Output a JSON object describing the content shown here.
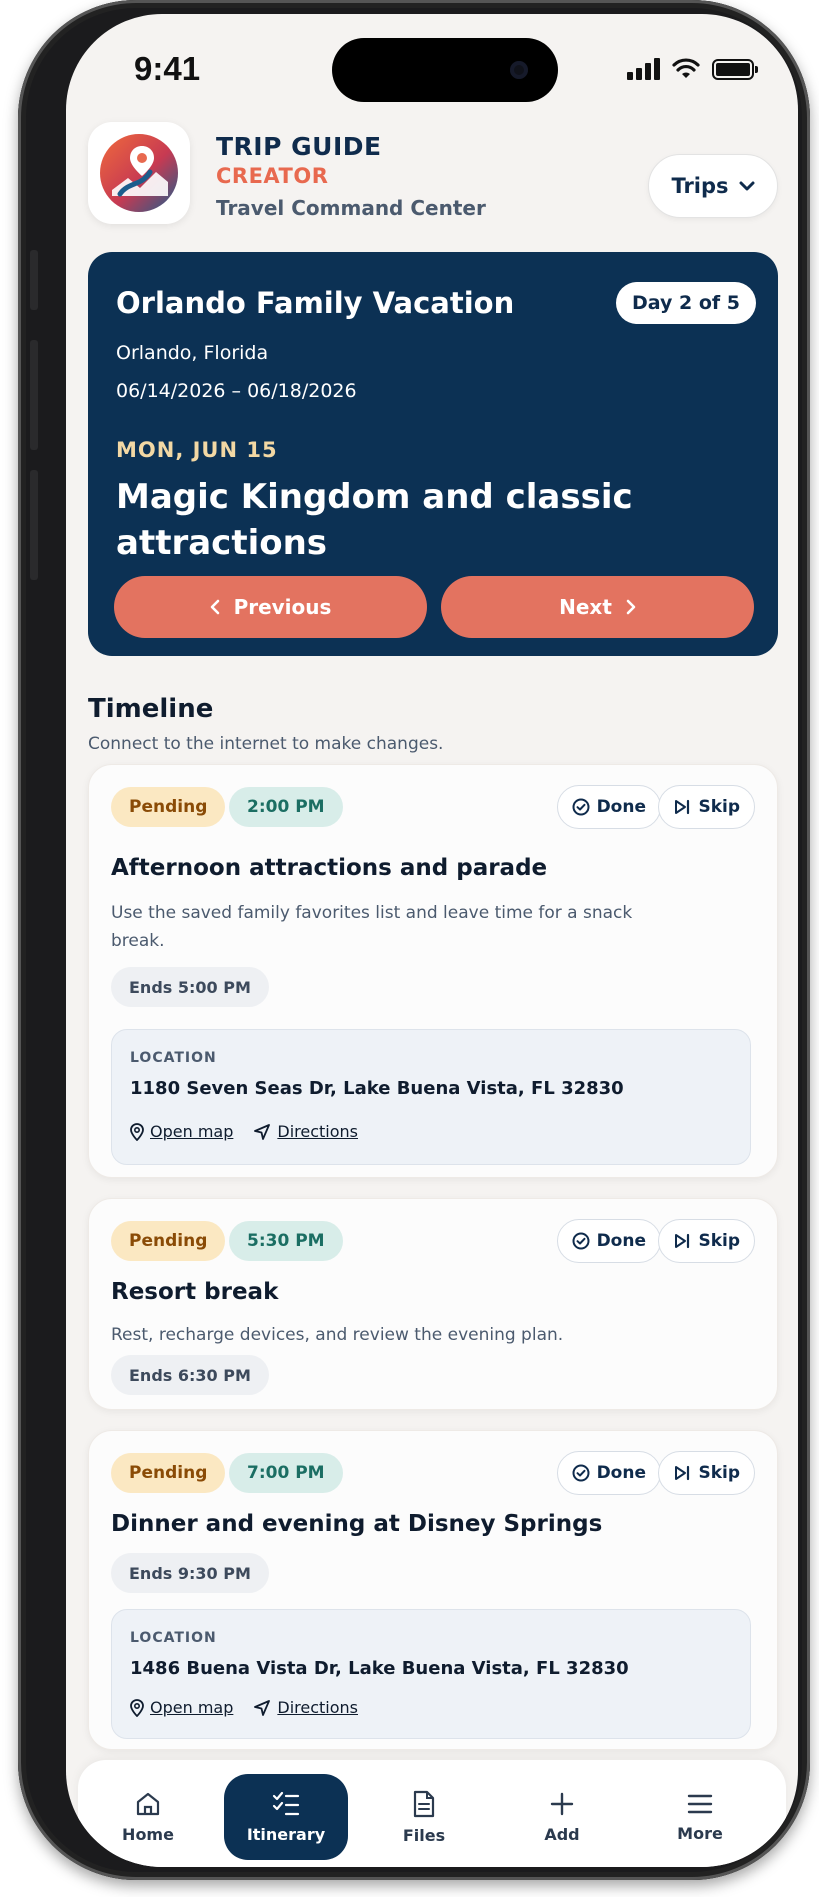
{
  "status_bar": {
    "time": "9:41"
  },
  "header": {
    "brand_line1": "TRIP GUIDE",
    "brand_line2": "CREATOR",
    "brand_line3": "Travel Command Center",
    "trips_label": "Trips"
  },
  "trip": {
    "title": "Orlando Family Vacation",
    "day_badge": "Day 2 of 5",
    "location": "Orlando, Florida",
    "dates": "06/14/2026 – 06/18/2026",
    "weekday": "MON, JUN 15",
    "plan": "Magic Kingdom and classic attractions",
    "prev_label": "Previous",
    "next_label": "Next"
  },
  "timeline": {
    "title": "Timeline",
    "subtitle": "Connect to the internet to make changes.",
    "done_label": "Done",
    "skip_label": "Skip",
    "location_label": "LOCATION",
    "open_map_label": "Open map",
    "directions_label": "Directions",
    "events": [
      {
        "status": "Pending",
        "time": "2:00 PM",
        "title": "Afternoon attractions and parade",
        "description": "Use the saved family favorites list and leave time for a snack break.",
        "ends": "Ends 5:00 PM",
        "address": "1180 Seven Seas Dr, Lake Buena Vista, FL 32830"
      },
      {
        "status": "Pending",
        "time": "5:30 PM",
        "title": "Resort break",
        "description": "Rest, recharge devices, and review the evening plan.",
        "ends": "Ends 6:30 PM"
      },
      {
        "status": "Pending",
        "time": "7:00 PM",
        "title": "Dinner and evening at Disney Springs",
        "ends": "Ends 9:30 PM",
        "address": "1486 Buena Vista Dr, Lake Buena Vista, FL 32830"
      }
    ]
  },
  "bottom_nav": {
    "active": "Itinerary",
    "tabs": [
      {
        "label": "Home",
        "icon": "home-icon"
      },
      {
        "label": "Itinerary",
        "icon": "checklist-icon"
      },
      {
        "label": "Files",
        "icon": "document-icon"
      },
      {
        "label": "Add",
        "icon": "plus-icon"
      },
      {
        "label": "More",
        "icon": "menu-icon"
      }
    ]
  },
  "colors": {
    "navy": "#0c3154",
    "coral": "#e37360",
    "brand_orange": "#e8694f",
    "pending_bg": "#fbe8c2",
    "time_bg": "#d8ede9",
    "screen_bg": "#f5f3f1"
  }
}
